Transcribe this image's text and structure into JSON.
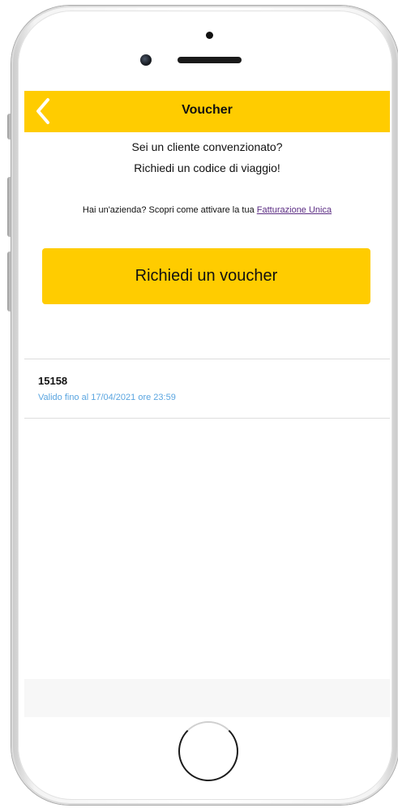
{
  "nav": {
    "title": "Voucher"
  },
  "intro": {
    "line1": "Sei un cliente convenzionato?",
    "line2": "Richiedi un codice di viaggio!"
  },
  "company": {
    "text": "Hai un'azienda? Scopri come attivare la tua ",
    "link_label": "Fatturazione Unica"
  },
  "request_button_label": "Richiedi un voucher",
  "vouchers": [
    {
      "code": "15158",
      "validity": "Valido fino al 17/04/2021 ore 23:59"
    }
  ],
  "colors": {
    "accent": "#ffcc00",
    "link": "#5b2c83",
    "validity_text": "#5aa5e0"
  },
  "icons": {
    "back": "chevron-left-icon"
  }
}
